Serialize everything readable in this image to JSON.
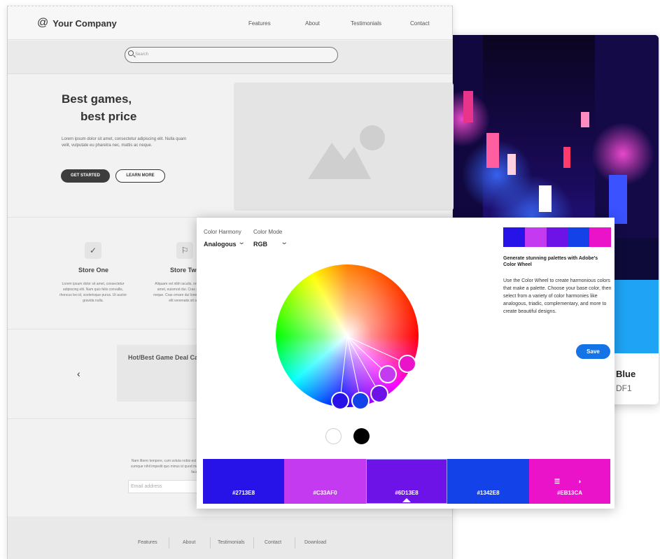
{
  "wireframe": {
    "logo_icon": "@",
    "logo_text": "Your Company",
    "nav": [
      "Features",
      "About",
      "Testimonials",
      "Contact"
    ],
    "search_placeholder": "Search",
    "hero_title_line1": "Best games,",
    "hero_title_line2": "best price",
    "hero_desc": "Lorem ipsum dolor sit amet, consectetur adipiscing elit. Nulla quam velit, vulputate eu pharetra nec, mattis ac neque.",
    "btn_primary": "GET STARTED",
    "btn_secondary": "LEARN MORE",
    "features": [
      {
        "icon": "✓",
        "title": "Store One",
        "desc": "Lorem ipsum dolor sit amet, consectetur adipiscing elit. Nam quis felis convallis, rhoncus leo id, scelerisque purus. Ut auctor gravida nulla."
      },
      {
        "icon": "⚐",
        "title": "Store Two",
        "desc": "Aliquam vel nibh iaculis, ornare purus sit amet, euismod dui. Cras sed tristique neque. Cras ornare dui lorem, vel rhoncus elit venenatis sit amet."
      }
    ],
    "deal_title": "Hot/Best Game Deal Cards",
    "carousel_prev": "‹",
    "newsletter_text": "Nam libero tempore, cum soluta nobis est eligendi optio cumque nihil impedit quo minus id quod maxime placeat facere possimus.",
    "email_placeholder": "Email address",
    "footer": [
      "Features",
      "About",
      "Testimonials",
      "Contact",
      "Download"
    ]
  },
  "photo_card": {
    "color_name": "Blue",
    "color_hex": "DF1",
    "accent": "#1fa3f4"
  },
  "color_wheel": {
    "harmony_label": "Color Harmony",
    "harmony_value": "Analogous",
    "mode_label": "Color Mode",
    "mode_value": "RGB",
    "title": "Generate stunning palettes with Adobe's Color Wheel",
    "description": "Use the Color Wheel to create harmonious colors that make a palette. Choose your base color, then select from a variety of color harmonies like analogous, triadic, complementary, and more to create beautiful designs.",
    "save_label": "Save",
    "palette": [
      {
        "hex": "#2713E8",
        "color": "#2713e8"
      },
      {
        "hex": "#C33AF0",
        "color": "#c33af0"
      },
      {
        "hex": "#6D13E8",
        "color": "#6d13e8"
      },
      {
        "hex": "#1342E8",
        "color": "#1342e8"
      },
      {
        "hex": "#EB13CA",
        "color": "#eb13ca"
      }
    ],
    "selected_index": 2,
    "base_icons": [
      "sliders-icon",
      "contrast-icon"
    ],
    "accent": "#1473e6"
  }
}
